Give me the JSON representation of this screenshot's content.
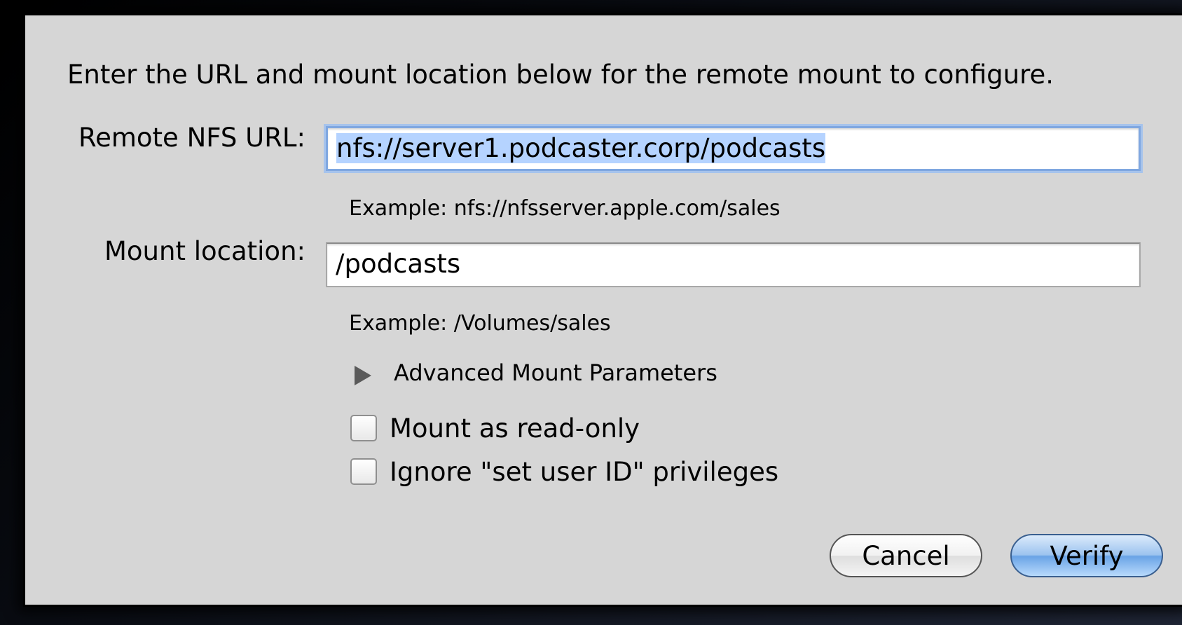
{
  "dialog": {
    "instructions": "Enter the URL and mount location below for the remote mount to configure.",
    "url_label": "Remote NFS URL:",
    "url_value": "nfs://server1.podcaster.corp/podcasts",
    "url_example": "Example: nfs://nfsserver.apple.com/sales",
    "mount_label": "Mount location:",
    "mount_value": "/podcasts",
    "mount_example": "Example: /Volumes/sales",
    "advanced_label": "Advanced Mount Parameters",
    "advanced_expanded": false,
    "checkboxes": [
      {
        "label": "Mount as read-only",
        "checked": false
      },
      {
        "label": "Ignore \"set user ID\" privileges",
        "checked": false
      }
    ],
    "cancel_label": "Cancel",
    "verify_label": "Verify",
    "accent_color": "#7fa7e0"
  }
}
